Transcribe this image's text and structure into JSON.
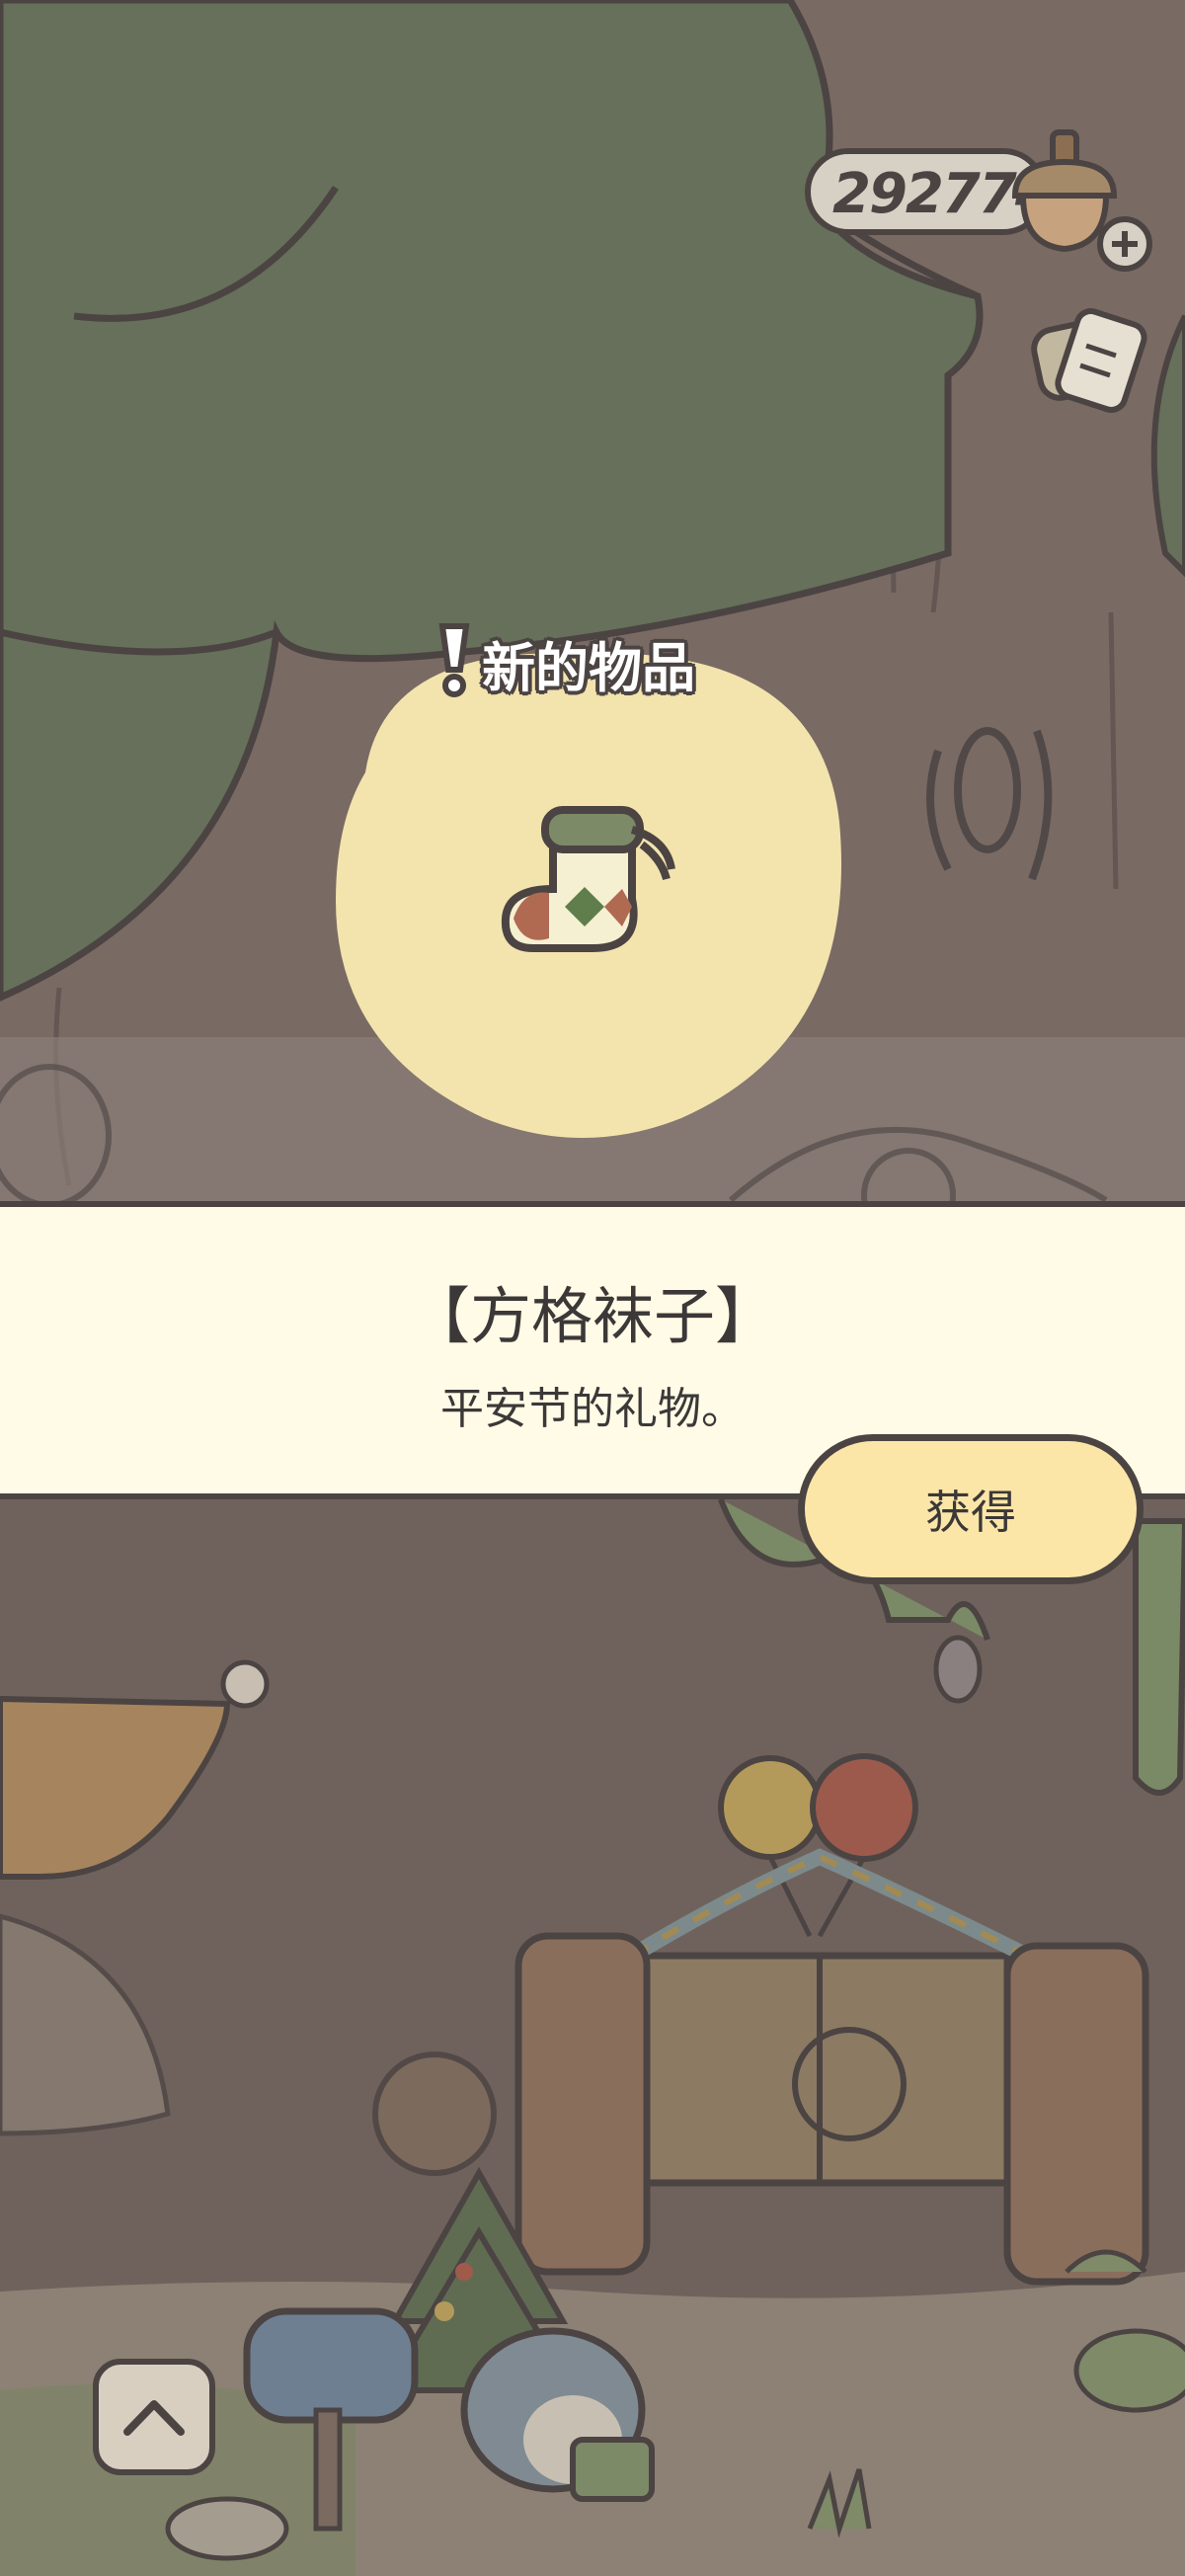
{
  "currency": {
    "value": "292774",
    "icon": "acorn-icon",
    "add_icon": "plus-icon"
  },
  "mail": {
    "icon": "letter-icon"
  },
  "popup": {
    "title": "新的物品",
    "title_icon": "exclamation-icon",
    "item_icon": "checkered-sock-icon"
  },
  "item": {
    "name": "【方格袜子】",
    "description": "平安节的礼物。"
  },
  "actions": {
    "get_label": "获得"
  },
  "nav": {
    "up_icon": "chevron-up-icon"
  },
  "colors": {
    "outline": "#4b4443",
    "banner_bg": "#fffbe6",
    "button_bg": "#fbe6a8",
    "blob_bg": "#f3e4ae",
    "tree_green": "#66705a",
    "trunk": "#7e6e68"
  }
}
